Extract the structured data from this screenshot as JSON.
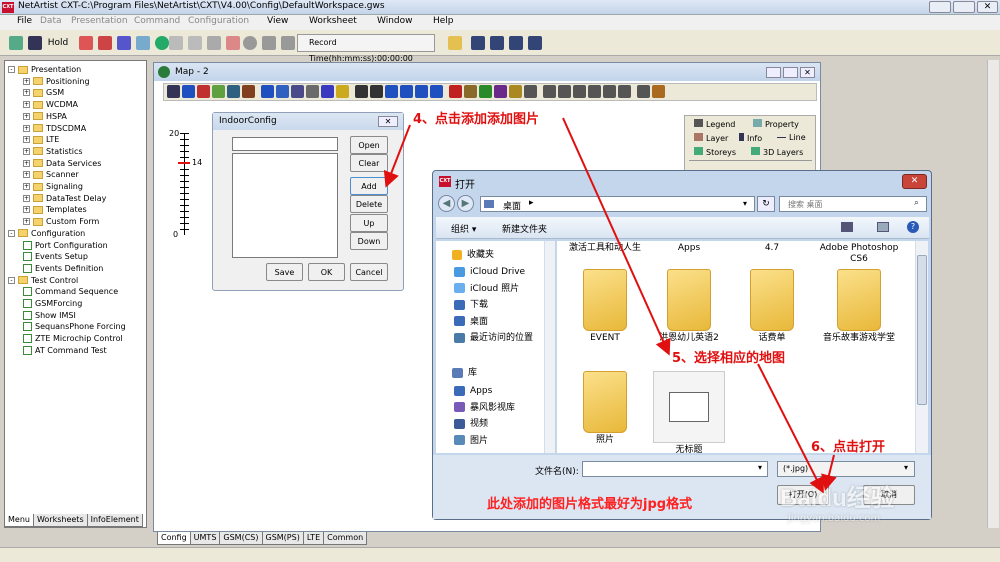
{
  "app": {
    "title": "NetArtist CXT-C:\\Program Files\\NetArtist\\CXT\\V4.00\\Config\\DefaultWorkspace.gws",
    "logo": "CXT"
  },
  "menu": [
    "File",
    "Data",
    "Presentation",
    "Command",
    "Configuration",
    "View",
    "Worksheet",
    "Window",
    "Help"
  ],
  "toolbar": {
    "hold": "Hold",
    "record_time": "Record Time(hh:mm:ss):00:00:00"
  },
  "tree": [
    {
      "label": "Presentation",
      "level": 0,
      "kind": "folder",
      "expand": "-"
    },
    {
      "label": "Positioning",
      "level": 1,
      "kind": "folder",
      "expand": "+"
    },
    {
      "label": "GSM",
      "level": 1,
      "kind": "folder",
      "expand": "+"
    },
    {
      "label": "WCDMA",
      "level": 1,
      "kind": "folder",
      "expand": "+"
    },
    {
      "label": "HSPA",
      "level": 1,
      "kind": "folder",
      "expand": "+"
    },
    {
      "label": "TDSCDMA",
      "level": 1,
      "kind": "folder",
      "expand": "+"
    },
    {
      "label": "LTE",
      "level": 1,
      "kind": "folder",
      "expand": "+"
    },
    {
      "label": "Statistics",
      "level": 1,
      "kind": "folder",
      "expand": "+"
    },
    {
      "label": "Data Services",
      "level": 1,
      "kind": "folder",
      "expand": "+"
    },
    {
      "label": "Scanner",
      "level": 1,
      "kind": "folder",
      "expand": "+"
    },
    {
      "label": "Signaling",
      "level": 1,
      "kind": "folder",
      "expand": "+"
    },
    {
      "label": "DataTest Delay",
      "level": 1,
      "kind": "folder",
      "expand": "+"
    },
    {
      "label": "Templates",
      "level": 1,
      "kind": "folder",
      "expand": "+"
    },
    {
      "label": "Custom Form",
      "level": 1,
      "kind": "folder",
      "expand": "+"
    },
    {
      "label": "Configuration",
      "level": 0,
      "kind": "folder",
      "expand": "-"
    },
    {
      "label": "Port Configuration",
      "level": 1,
      "kind": "leaf"
    },
    {
      "label": "Events Setup",
      "level": 1,
      "kind": "leaf"
    },
    {
      "label": "Events Definition",
      "level": 1,
      "kind": "leaf"
    },
    {
      "label": "Test Control",
      "level": 0,
      "kind": "folder",
      "expand": "-"
    },
    {
      "label": "Command Sequence",
      "level": 1,
      "kind": "leaf"
    },
    {
      "label": "GSMForcing",
      "level": 1,
      "kind": "leaf"
    },
    {
      "label": "Show IMSI",
      "level": 1,
      "kind": "leaf"
    },
    {
      "label": "SequansPhone Forcing",
      "level": 1,
      "kind": "leaf"
    },
    {
      "label": "ZTE Microchip Control",
      "level": 1,
      "kind": "leaf"
    },
    {
      "label": "AT Command Test",
      "level": 1,
      "kind": "leaf"
    }
  ],
  "left_tabs": [
    "Menu",
    "Worksheets",
    "InfoElement"
  ],
  "bottom_tabs": [
    "Config",
    "UMTS",
    "GSM(CS)",
    "GSM(PS)",
    "LTE",
    "Common"
  ],
  "map": {
    "title": "Map - 2",
    "scale_top": "20",
    "scale_mid": "14",
    "scale_bottom": "0"
  },
  "legend_panel": {
    "legend": "Legend",
    "property": "Property",
    "layer": "Layer",
    "info": "Info",
    "line": "Line",
    "storeys": "Storeys",
    "layers3d": "3D Layers"
  },
  "indoor": {
    "title": "IndoorConfig",
    "open": "Open",
    "clear": "Clear",
    "add": "Add",
    "delete": "Delete",
    "up": "Up",
    "down": "Down",
    "save": "Save",
    "ok": "OK",
    "cancel": "Cancel"
  },
  "open_dialog": {
    "title": "打开",
    "logo": "CXT",
    "location": "桌面",
    "search_placeholder": "搜索 桌面",
    "organize": "组织 ▾",
    "new_folder": "新建文件夹",
    "favorites_header": "收藏夹",
    "favorites": [
      "iCloud Drive",
      "iCloud 照片",
      "下载",
      "桌面",
      "最近访问的位置"
    ],
    "library_header": "库",
    "library": [
      "Apps",
      "暴风影视库",
      "视频",
      "图片"
    ],
    "files": [
      {
        "name": "激活工具和动人生",
        "kind": "label"
      },
      {
        "name": "Apps",
        "kind": "label"
      },
      {
        "name": "4.7",
        "kind": "label"
      },
      {
        "name": "Adobe Photoshop CS6",
        "kind": "label"
      },
      {
        "name": "EVENT",
        "kind": "folder"
      },
      {
        "name": "洪恩幼儿英语2",
        "kind": "folder"
      },
      {
        "name": "话费单",
        "kind": "folder"
      },
      {
        "name": "音乐故事游戏学堂",
        "kind": "folder"
      },
      {
        "name": "照片",
        "kind": "folder"
      },
      {
        "name": "无标题",
        "kind": "image"
      }
    ],
    "filename_label": "文件名(N):",
    "filename_value": "",
    "filter": "(*.jpg)",
    "open_btn": "打开(O)",
    "cancel_btn": "取消"
  },
  "annotations": {
    "step4": "4、点击添加添加图片",
    "step5": "5、选择相应的地图",
    "step6": "6、点击打开",
    "note": "此处添加的图片格式最好为jpg格式"
  },
  "watermark": {
    "brand": "Baidu经验",
    "url": "jingyan.baidu.com"
  },
  "colors": {
    "annot": "#e01010",
    "note": "#ff2020",
    "folder": "#f5c842"
  }
}
